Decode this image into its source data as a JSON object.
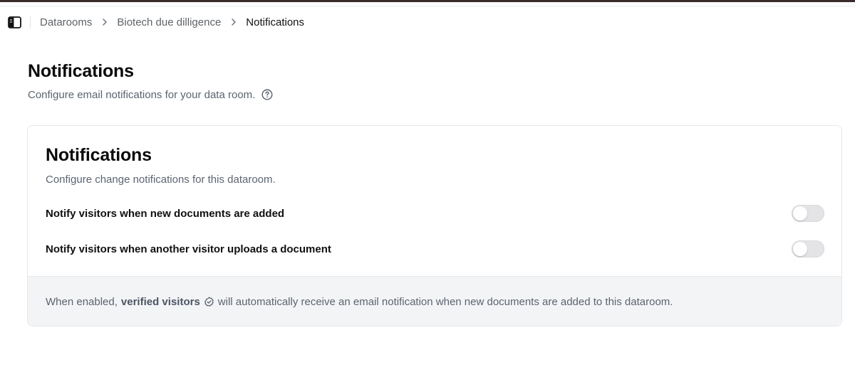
{
  "breadcrumb": {
    "items": [
      "Datarooms",
      "Biotech due dilligence"
    ],
    "current": "Notifications"
  },
  "page": {
    "title": "Notifications",
    "subtitle": "Configure email notifications for your data room."
  },
  "card": {
    "title": "Notifications",
    "description": "Configure change notifications for this dataroom.",
    "settings": [
      {
        "label": "Notify visitors when new documents are added",
        "enabled": false
      },
      {
        "label": "Notify visitors when another visitor uploads a document",
        "enabled": false
      }
    ],
    "footer": {
      "prefix": "When enabled,",
      "bold": "verified visitors",
      "suffix": "will automatically receive an email notification when new documents are added to this dataroom."
    }
  },
  "icons": {
    "sidebar_toggle": "sidebar-panel-icon",
    "separator": "chevron-right-icon",
    "help": "question-circle-icon",
    "verified": "check-circle-icon"
  },
  "colors": {
    "accent_top_strip": "#3b2a2a",
    "muted_text": "#5b6470",
    "footer_bg": "#f3f4f6",
    "toggle_off": "#e4e4e7"
  }
}
